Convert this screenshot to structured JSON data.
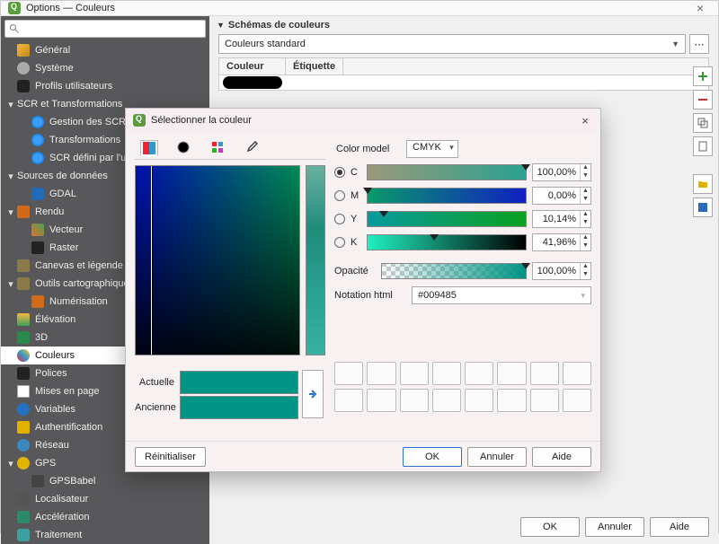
{
  "window": {
    "title": "Options — Couleurs"
  },
  "search": {
    "placeholder": ""
  },
  "sidebar": {
    "items": [
      {
        "label": "Général"
      },
      {
        "label": "Système"
      },
      {
        "label": "Profils utilisateurs"
      },
      {
        "label": "SCR et Transformations"
      },
      {
        "label": "Gestion des SCR"
      },
      {
        "label": "Transformations"
      },
      {
        "label": "SCR défini par l'utilisateur"
      },
      {
        "label": "Sources de données"
      },
      {
        "label": "GDAL"
      },
      {
        "label": "Rendu"
      },
      {
        "label": "Vecteur"
      },
      {
        "label": "Raster"
      },
      {
        "label": "Canevas et légende"
      },
      {
        "label": "Outils cartographiques"
      },
      {
        "label": "Numérisation"
      },
      {
        "label": "Élévation"
      },
      {
        "label": "3D"
      },
      {
        "label": "Couleurs"
      },
      {
        "label": "Polices"
      },
      {
        "label": "Mises en page"
      },
      {
        "label": "Variables"
      },
      {
        "label": "Authentification"
      },
      {
        "label": "Réseau"
      },
      {
        "label": "GPS"
      },
      {
        "label": "GPSBabel"
      },
      {
        "label": "Localisateur"
      },
      {
        "label": "Accélération"
      },
      {
        "label": "Traitement"
      }
    ]
  },
  "main": {
    "schemes_title": "Schémas de couleurs",
    "scheme_combo": "Couleurs standard",
    "table": {
      "col_color": "Couleur",
      "col_label": "Étiquette"
    },
    "buttons": {
      "ok": "OK",
      "cancel": "Annuler",
      "help": "Aide"
    }
  },
  "picker": {
    "title": "Sélectionner la couleur",
    "color_model_label": "Color model",
    "color_model_value": "CMYK",
    "channels": {
      "c": {
        "label": "C",
        "value": "100,00%",
        "knob": 100
      },
      "m": {
        "label": "M",
        "value": "0,00%",
        "knob": 0
      },
      "y": {
        "label": "Y",
        "value": "10,14%",
        "knob": 10
      },
      "k": {
        "label": "K",
        "value": "41,96%",
        "knob": 42
      }
    },
    "opacity": {
      "label": "Opacité",
      "value": "100,00%",
      "knob": 100
    },
    "hex": {
      "label": "Notation html",
      "value": "#009485"
    },
    "current_label": "Actuelle",
    "previous_label": "Ancienne",
    "reset": "Réinitialiser",
    "ok": "OK",
    "cancel": "Annuler",
    "help": "Aide"
  }
}
